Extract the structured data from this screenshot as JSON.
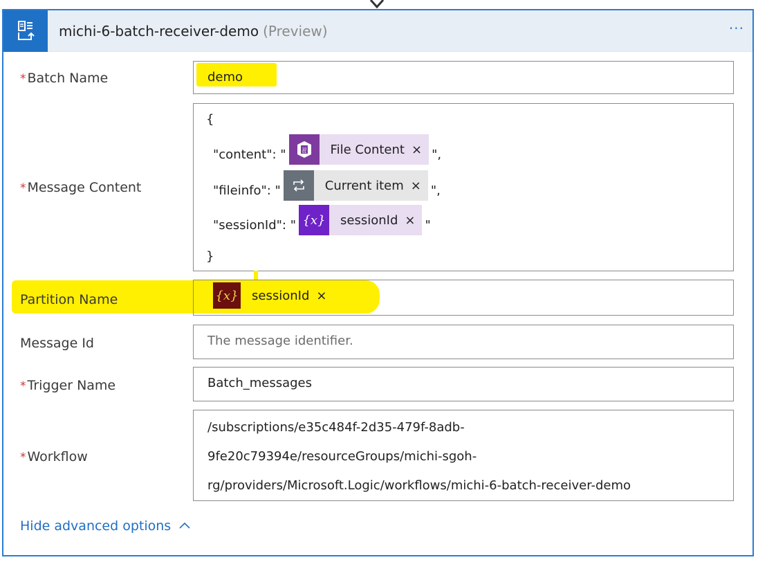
{
  "action": {
    "title": "michi-6-batch-receiver-demo",
    "preview_tag": "(Preview)",
    "more_label": "···"
  },
  "fields": {
    "batch_name": {
      "label": "Batch Name",
      "required": "*",
      "value": "demo"
    },
    "message_content": {
      "label": "Message Content",
      "required": "*",
      "open_brace": "{",
      "close_brace": "}",
      "lines": [
        {
          "key": "\"content\": \"",
          "token": "File Content",
          "suffix": "\","
        },
        {
          "key": "\"fileinfo\": \"",
          "token": "Current item",
          "suffix": "\","
        },
        {
          "key": "\"sessionId\": \"",
          "token": "sessionId",
          "suffix": "\""
        }
      ]
    },
    "partition_name": {
      "label": "Partition Name",
      "token": "sessionId"
    },
    "message_id": {
      "label": "Message Id",
      "placeholder": "The message identifier."
    },
    "trigger_name": {
      "label": "Trigger Name",
      "required": "*",
      "value": "Batch_messages"
    },
    "workflow": {
      "label": "Workflow",
      "required": "*",
      "lines": [
        "/subscriptions/e35c484f-2d35-479f-8adb-",
        "9fe20c79394e/resourceGroups/michi-sgoh-",
        "rg/providers/Microsoft.Logic/workflows/michi-6-batch-receiver-demo"
      ]
    }
  },
  "token_close": "×",
  "advanced_toggle": {
    "label": "Hide advanced options",
    "chevron": "^"
  },
  "icons": {
    "action": "batch-send-icon",
    "file_content": "blob-file-icon",
    "current_item": "foreach-loop-icon",
    "variable": "variable-x-icon"
  },
  "colors": {
    "accent": "#2b7cd3",
    "header_bg": "#e8eef5",
    "required": "#d13438",
    "highlight": "#ffef00",
    "link": "#1f6fc4"
  }
}
